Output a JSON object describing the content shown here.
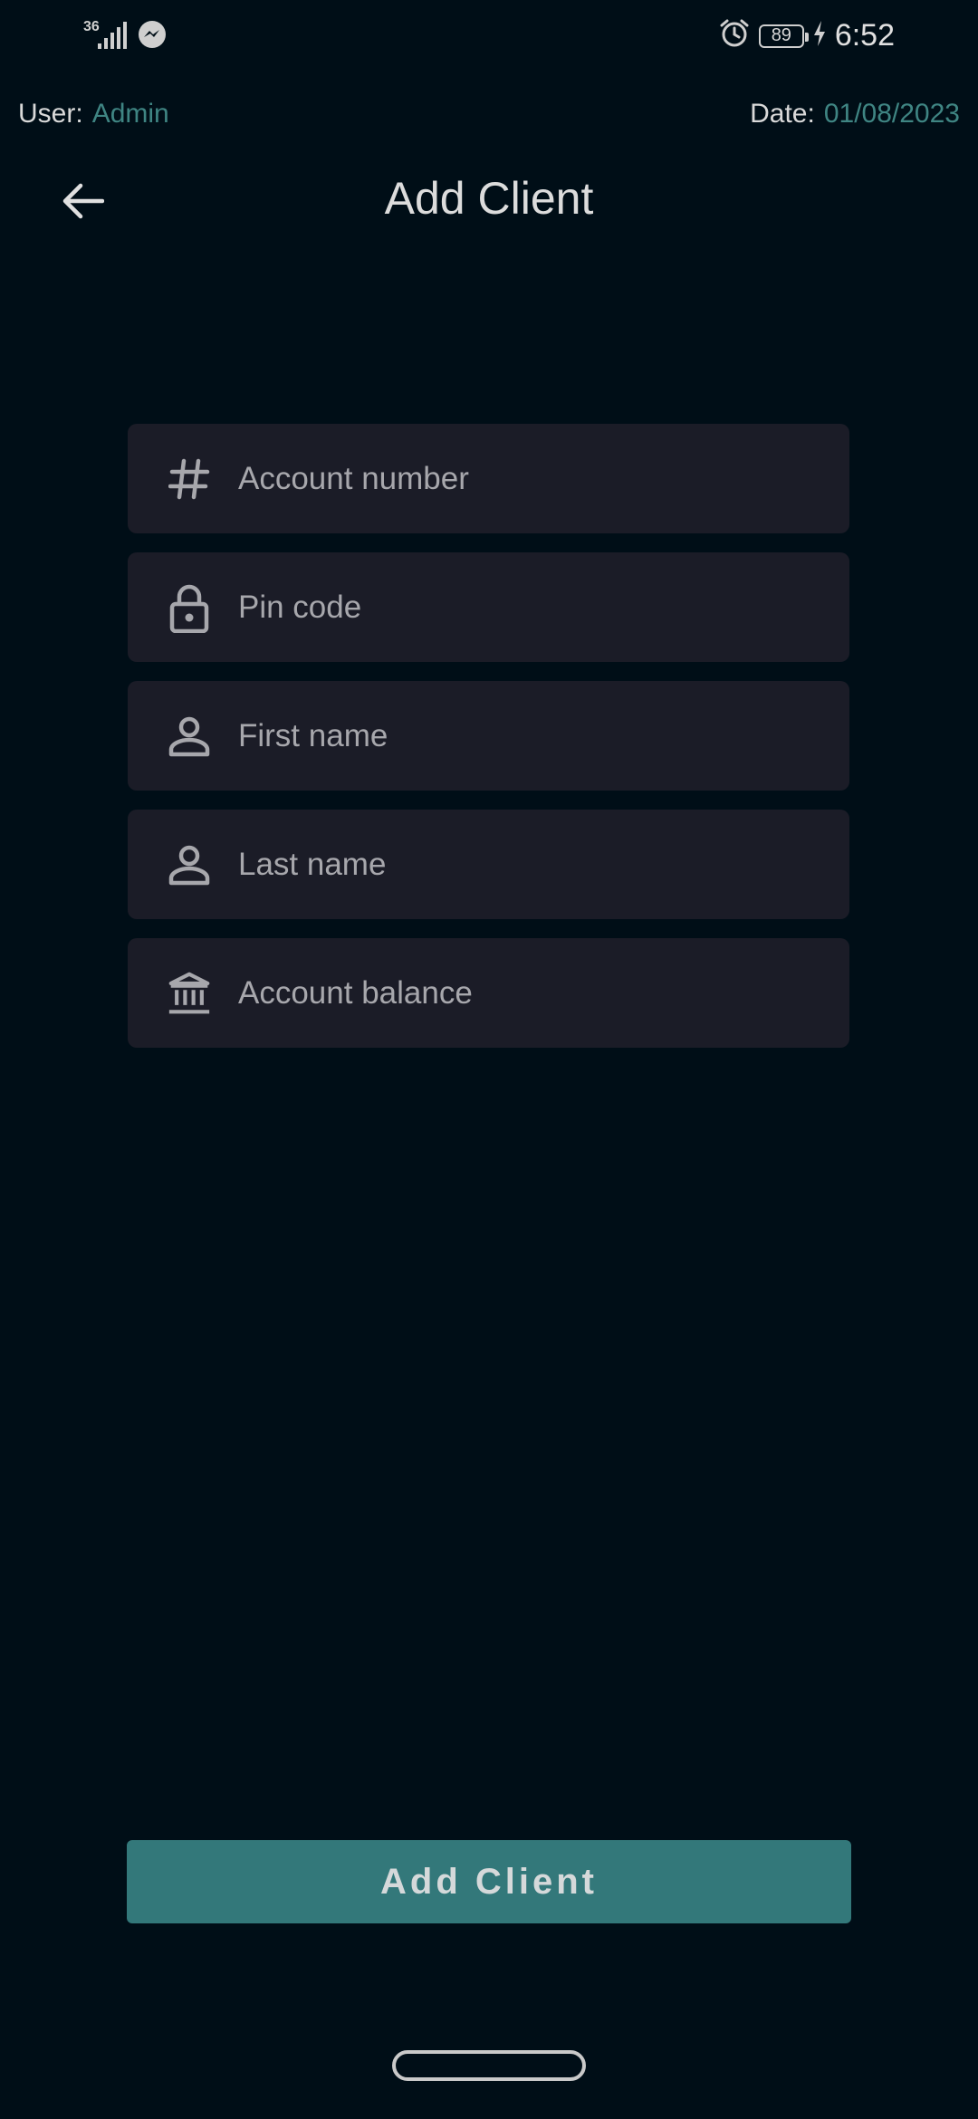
{
  "status_bar": {
    "network_type": "36",
    "battery_level": "89",
    "time": "6:52",
    "icons": [
      "signal-icon",
      "messenger-icon",
      "alarm-icon",
      "battery-icon",
      "charging-icon"
    ]
  },
  "info": {
    "user_label": "User:",
    "user_value": "Admin",
    "date_label": "Date:",
    "date_value": "01/08/2023"
  },
  "header": {
    "title": "Add Client",
    "back_icon": "arrow-left-icon"
  },
  "form": {
    "fields": [
      {
        "placeholder": "Account number",
        "value": "",
        "icon": "hash-icon"
      },
      {
        "placeholder": "Pin code",
        "value": "",
        "icon": "lock-icon"
      },
      {
        "placeholder": "First name",
        "value": "",
        "icon": "person-icon"
      },
      {
        "placeholder": "Last name",
        "value": "",
        "icon": "person-icon"
      },
      {
        "placeholder": "Account balance",
        "value": "",
        "icon": "bank-icon"
      }
    ]
  },
  "submit": {
    "label": "Add Client"
  },
  "colors": {
    "background": "#000e17",
    "field_background": "#1b1c27",
    "accent": "#33787a",
    "info_value": "#3f8583",
    "placeholder": "#a7a7ac"
  }
}
